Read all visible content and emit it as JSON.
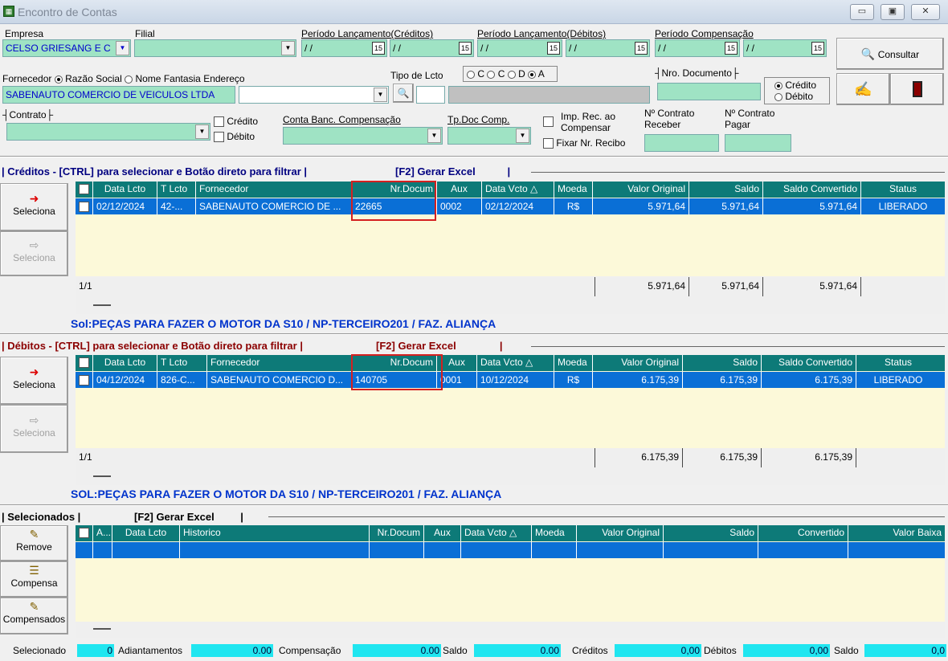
{
  "window": {
    "title": "Encontro de Contas",
    "icon": "app-grid-icon"
  },
  "filters": {
    "empresa_label": "Empresa",
    "empresa_value": "CELSO GRIESANG E C",
    "filial_label": "Filial",
    "periodo_cred_label": "Período Lançamento(Créditos)",
    "periodo_deb_label": "Período Lançamento(Débitos)",
    "periodo_comp_label": "Período Compensação",
    "date_placeholder": "/ /",
    "cal_label": "15",
    "consultar_label": "Consultar",
    "fornecedor_label": "Fornecedor",
    "razao_social_label": "Razão Social",
    "nome_fantasia_label": "Nome Fantasia",
    "endereco_label": "Endereço",
    "fornecedor_value": "SABENAUTO COMERCIO DE VEICULOS LTDA",
    "tipo_lcto_label": "Tipo de Lcto",
    "tipo_c": "C",
    "tipo_cc": "C",
    "tipo_d": "D",
    "tipo_a": "A",
    "nro_doc_label": "Nro. Documento",
    "credito_label": "Crédito",
    "debito_label": "Débito",
    "contrato_label": "Contrato",
    "conta_banc_label": "Conta Banc. Compensação",
    "tpdoc_label": "Tp.Doc Comp.",
    "imp_rec_label": "Imp. Rec. ao Compensar",
    "fixar_label": "Fixar Nr. Recibo",
    "contrato_receber_label": "Nº Contrato Receber",
    "contrato_pagar_label": "Nº Contrato Pagar"
  },
  "creditos": {
    "header": "| Créditos - [CTRL] para selecionar e Botão direto para filtrar |",
    "excel": "[F2] Gerar Excel",
    "seleciona_label": "Seleciona",
    "columns": [
      "Data Lcto",
      "T Lcto",
      "Fornecedor",
      "Nr.Docum",
      "Aux",
      "Data Vcto △",
      "Moeda",
      "Valor Original",
      "Saldo",
      "Saldo Convertido",
      "Status"
    ],
    "rows": [
      [
        "02/12/2024",
        "42-...",
        "SABENAUTO COMERCIO DE ...",
        "22665",
        "0002",
        "02/12/2024",
        "R$",
        "5.971,64",
        "5.971,64",
        "5.971,64",
        "LIBERADO"
      ]
    ],
    "pager": "1/1",
    "totals": [
      "5.971,64",
      "5.971,64",
      "5.971,64"
    ],
    "sol": "Sol:PEÇAS PARA FAZER O MOTOR DA S10 / NP-TERCEIRO201 / FAZ. ALIANÇA"
  },
  "debitos": {
    "header": "| Débitos - [CTRL] para selecionar e Botão direto para filtrar |",
    "excel": "[F2] Gerar Excel",
    "seleciona_label": "Seleciona",
    "columns": [
      "Data Lcto",
      "T Lcto",
      "Fornecedor",
      "Nr.Docum",
      "Aux",
      "Data Vcto △",
      "Moeda",
      "Valor Original",
      "Saldo",
      "Saldo Convertido",
      "Status"
    ],
    "rows": [
      [
        "04/12/2024",
        "826-C...",
        "SABENAUTO COMERCIO D...",
        "140705",
        "0001",
        "10/12/2024",
        "R$",
        "6.175,39",
        "6.175,39",
        "6.175,39",
        "LIBERADO"
      ]
    ],
    "pager": "1/1",
    "totals": [
      "6.175,39",
      "6.175,39",
      "6.175,39"
    ],
    "sol": "SOL:PEÇAS PARA FAZER O MOTOR DA S10 / NP-TERCEIRO201 / FAZ. ALIANÇA"
  },
  "selecionados": {
    "header": "| Selecionados |",
    "excel": "[F2] Gerar Excel",
    "columns": [
      "A...",
      "Data Lcto",
      "Historico",
      "Nr.Docum",
      "Aux",
      "Data Vcto △",
      "Moeda",
      "Valor Original",
      "Saldo",
      "Convertido",
      "Valor Baixa"
    ],
    "remove_label": "Remove",
    "compensa_label": "Compensa",
    "compensados_label": "Compensados"
  },
  "status": {
    "selecionado_label": "Selecionado",
    "selecionado_value": "0",
    "adiantamentos_label": "Adiantamentos",
    "adiantamentos_value": "0.00",
    "compensacao_label": "Compensação",
    "compensacao_value": "0.00",
    "saldo_label": "Saldo",
    "saldo_value": "0.00",
    "creditos_label": "Créditos",
    "creditos_value": "0,00",
    "debitos_label": "Débitos",
    "debitos_value": "0,00",
    "saldo2_label": "Saldo",
    "saldo2_value": "0,0"
  },
  "colors": {
    "header_teal": "#0d7a78",
    "row_blue": "#0a6fd6",
    "grid_bg": "#fcf9d9",
    "field_green": "#9fe3c4",
    "status_cyan": "#20e6f0",
    "highlight_red": "#d42020"
  }
}
